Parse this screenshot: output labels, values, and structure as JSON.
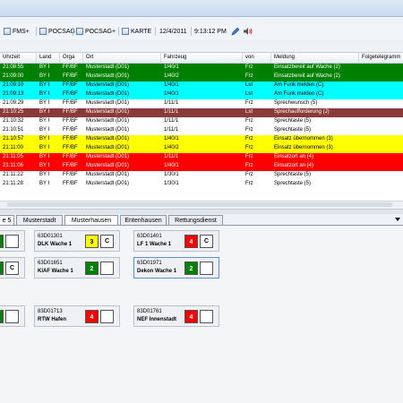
{
  "toolbar": {
    "items": [
      {
        "icon": "fms-icon",
        "label": "FMS+"
      },
      {
        "icon": "pocsag-icon",
        "label": "POCSAG"
      },
      {
        "icon": "pocsag-plus-icon",
        "label": "POCSAG+"
      },
      {
        "icon": "map-icon",
        "label": "KARTE"
      }
    ],
    "date": "12/4/2011",
    "time": "9:13:12 PM",
    "pen_icon": "pen-icon",
    "speaker_icon": "speaker-icon"
  },
  "grid": {
    "headers": [
      "Uhrzeit",
      "Land",
      "Orga",
      "Ort",
      "Fahrzeug",
      "von",
      "Meldung",
      "Folgetelegramm"
    ],
    "rows": [
      {
        "bg": "#008000",
        "fg": "#ffffff",
        "cells": [
          "21:08:55",
          "BY I",
          "FF/BF",
          "Musterstadt (D01)",
          "1/40/1",
          "Frz",
          "Einsatzbereit auf Wache (2)",
          ""
        ]
      },
      {
        "bg": "#008000",
        "fg": "#ffffff",
        "cells": [
          "21:09:00",
          "BY I",
          "FF/BF",
          "Musterstadt (D01)",
          "1/40/2",
          "Frz",
          "Einsatzbereit auf Wache (2)",
          ""
        ]
      },
      {
        "bg": "#00ffff",
        "fg": "#000000",
        "cells": [
          "21:09:10",
          "BY I",
          "FF/BF",
          "Musterstadt (D01)",
          "1/40/1",
          "Lst",
          "Am Funk melden (C)",
          ""
        ]
      },
      {
        "bg": "#00ffff",
        "fg": "#000000",
        "cells": [
          "21:09:13",
          "BY I",
          "FF/BF",
          "Musterstadt (D01)",
          "1/40/1",
          "Lst",
          "Am Funk melden (C)",
          ""
        ]
      },
      {
        "bg": "#ffffff",
        "fg": "#000000",
        "cells": [
          "21:09:29",
          "BY I",
          "FF/BF",
          "Musterstadt (D01)",
          "1/11/1",
          "Frz",
          "Sprechwunsch (5)",
          ""
        ]
      },
      {
        "bg": "#8b3a3a",
        "fg": "#ffffff",
        "cells": [
          "21:10:25",
          "BY I",
          "FF/BF",
          "Musterstadt (D01)",
          "1/11/1",
          "Lst",
          "Sprechaufforderung (J)",
          ""
        ]
      },
      {
        "bg": "#ffffff",
        "fg": "#000000",
        "cells": [
          "21:10:32",
          "BY I",
          "FF/BF",
          "Musterstadt (D01)",
          "1/11/1",
          "Frz",
          "Sprechtaste (5)",
          ""
        ]
      },
      {
        "bg": "#ffffff",
        "fg": "#000000",
        "cells": [
          "21:10:51",
          "BY I",
          "FF/BF",
          "Musterstadt (D01)",
          "1/11/1",
          "Frz",
          "Sprechtaste (5)",
          ""
        ]
      },
      {
        "bg": "#ffff00",
        "fg": "#000000",
        "cells": [
          "21:10:57",
          "BY I",
          "FF/BF",
          "Musterstadt (D01)",
          "1/40/1",
          "Frz",
          "Einsatz übernommen (3)",
          ""
        ]
      },
      {
        "bg": "#ffff00",
        "fg": "#000000",
        "cells": [
          "21:11:00",
          "BY I",
          "FF/BF",
          "Musterstadt (D01)",
          "1/40/2",
          "Frz",
          "Einsatz übernommen (3)",
          ""
        ]
      },
      {
        "bg": "#ff0000",
        "fg": "#ffffff",
        "cells": [
          "21:11:05",
          "BY I",
          "FF/BF",
          "Musterstadt (D01)",
          "1/11/1",
          "Frz",
          "Einsatzort an (4)",
          ""
        ]
      },
      {
        "bg": "#ff0000",
        "fg": "#ffffff",
        "cells": [
          "21:11:06",
          "BY I",
          "FF/BF",
          "Musterstadt (D01)",
          "1/40/1",
          "Frz",
          "Einsatzort an (4)",
          ""
        ]
      },
      {
        "bg": "#ffffff",
        "fg": "#000000",
        "cells": [
          "21:11:22",
          "BY I",
          "FF/BF",
          "Musterstadt (D01)",
          "1/30/1",
          "Frz",
          "Sprechtaste (5)",
          ""
        ]
      },
      {
        "bg": "#ffffff",
        "fg": "#000000",
        "cells": [
          "21:11:28",
          "BY I",
          "FF/BF",
          "Musterstadt (D01)",
          "1/30/1",
          "Frz",
          "Sprechtaste (5)",
          ""
        ]
      }
    ]
  },
  "tabs": [
    "e 5",
    "Musterstadt",
    "Musterhausen",
    "Entenhausen",
    "Rettungsdienst"
  ],
  "units": {
    "u1": {
      "code": "63D01301",
      "name": "DLK Wache 1",
      "status": "3",
      "status_color": "#ffff00",
      "wb": "C"
    },
    "u2": {
      "code": "63D01401",
      "name": "LF 1 Wache 1",
      "status": "4",
      "status_color": "#ff0000",
      "wb": "C"
    },
    "u3": {
      "code": "63D01651",
      "name": "KlAF Wache 1",
      "status": "2",
      "status_color": "#008000",
      "wb": ""
    },
    "u4": {
      "code": "63D01971",
      "name": "Dekon Wache 1",
      "status": "2",
      "status_color": "#008000",
      "wb": ""
    },
    "u5": {
      "code": "83D01713",
      "name": "RTW Hafen",
      "status": "4",
      "status_color": "#ff0000",
      "wb": ""
    },
    "u6": {
      "code": "83D01761",
      "name": "NEF Innenstadt",
      "status": "4",
      "status_color": "#ff0000",
      "wb": ""
    },
    "p1": {
      "status_color": "#008000",
      "wb": ""
    },
    "p2": {
      "status_color": "#008000",
      "wb": "C"
    },
    "p3": {
      "status_color": "#008000",
      "wb": ""
    }
  }
}
